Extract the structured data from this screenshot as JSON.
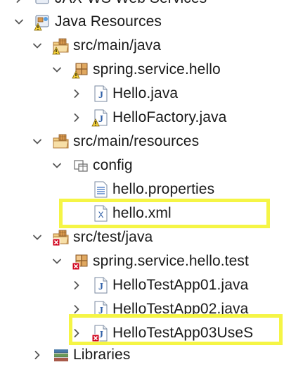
{
  "tree": {
    "partial_top_label": "JAX-WS Web Services",
    "items": [
      {
        "label": "Java Resources"
      },
      {
        "label": "src/main/java"
      },
      {
        "label": "spring.service.hello"
      },
      {
        "label": "Hello.java"
      },
      {
        "label": "HelloFactory.java"
      },
      {
        "label": "src/main/resources"
      },
      {
        "label": "config"
      },
      {
        "label": "hello.properties"
      },
      {
        "label": "hello.xml"
      },
      {
        "label": "src/test/java"
      },
      {
        "label": "spring.service.hello.test"
      },
      {
        "label": "HelloTestApp01.java"
      },
      {
        "label": "HelloTestApp02.java"
      },
      {
        "label": "HelloTestApp03UseS"
      },
      {
        "label": "Libraries"
      }
    ]
  },
  "colors": {
    "highlight": "#f5f545",
    "error_red": "#d0021b",
    "package_brown": "#b07a3a",
    "java_blue": "#2f5fa8"
  }
}
